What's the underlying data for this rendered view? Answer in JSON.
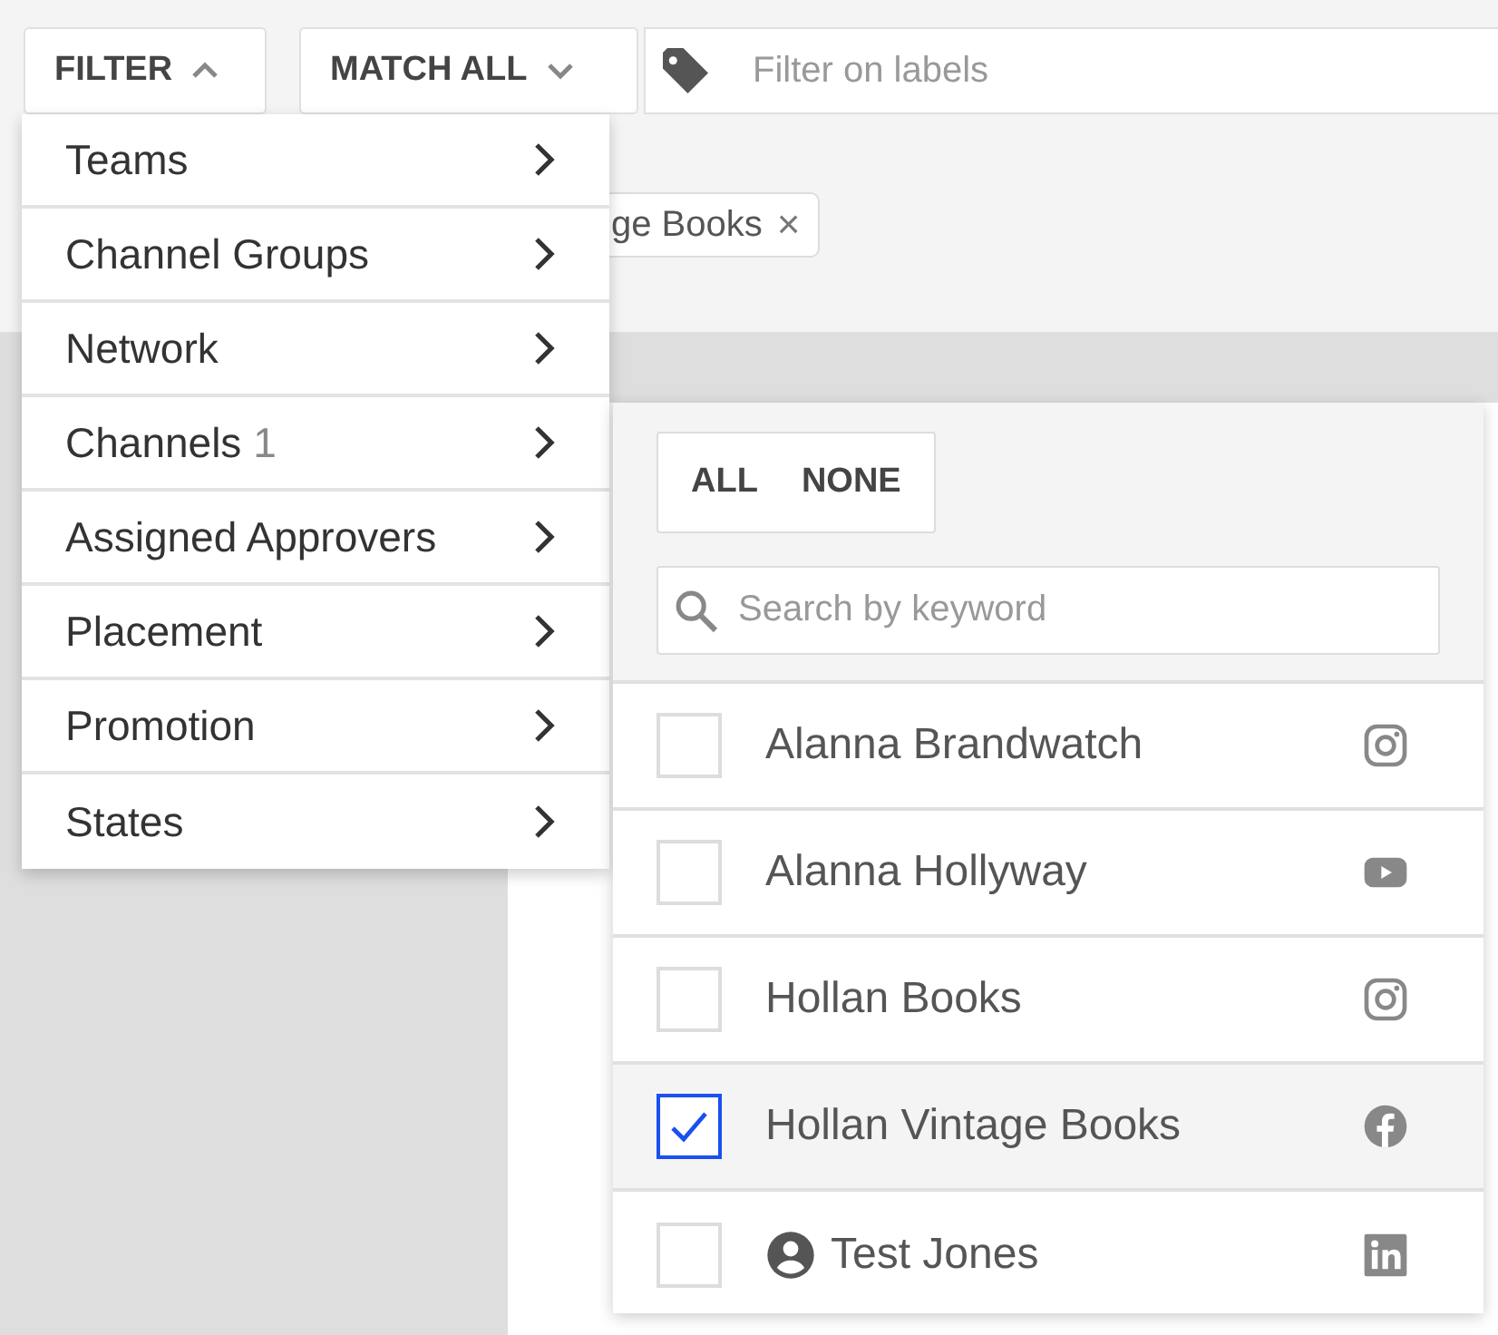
{
  "toolbar": {
    "filter_button": {
      "label": "FILTER",
      "expanded": true
    },
    "match_button": {
      "label": "MATCH ALL",
      "expanded": false
    },
    "label_search": {
      "placeholder": "Filter on labels"
    }
  },
  "active_chips": [
    {
      "label": "ge Books",
      "remove": "×"
    }
  ],
  "filter_menu": [
    {
      "label": "Teams"
    },
    {
      "label": "Channel Groups"
    },
    {
      "label": "Network"
    },
    {
      "label": "Channels",
      "count": "1"
    },
    {
      "label": "Assigned Approvers"
    },
    {
      "label": "Placement"
    },
    {
      "label": "Promotion"
    },
    {
      "label": "States"
    }
  ],
  "channels_panel": {
    "select_buttons": [
      "ALL",
      "NONE"
    ],
    "search": {
      "placeholder": "Search by keyword"
    },
    "channels": [
      {
        "name": "Alanna Brandwatch",
        "kind": "instagram",
        "checked": false,
        "avatar": false
      },
      {
        "name": "Alanna Hollyway",
        "kind": "youtube",
        "checked": false,
        "avatar": false
      },
      {
        "name": "Hollan Books",
        "kind": "instagram",
        "checked": false,
        "avatar": false
      },
      {
        "name": "Hollan Vintage Books",
        "kind": "facebook",
        "checked": true,
        "avatar": false
      },
      {
        "name": "Test Jones",
        "kind": "linkedin",
        "checked": false,
        "avatar": true
      }
    ]
  }
}
